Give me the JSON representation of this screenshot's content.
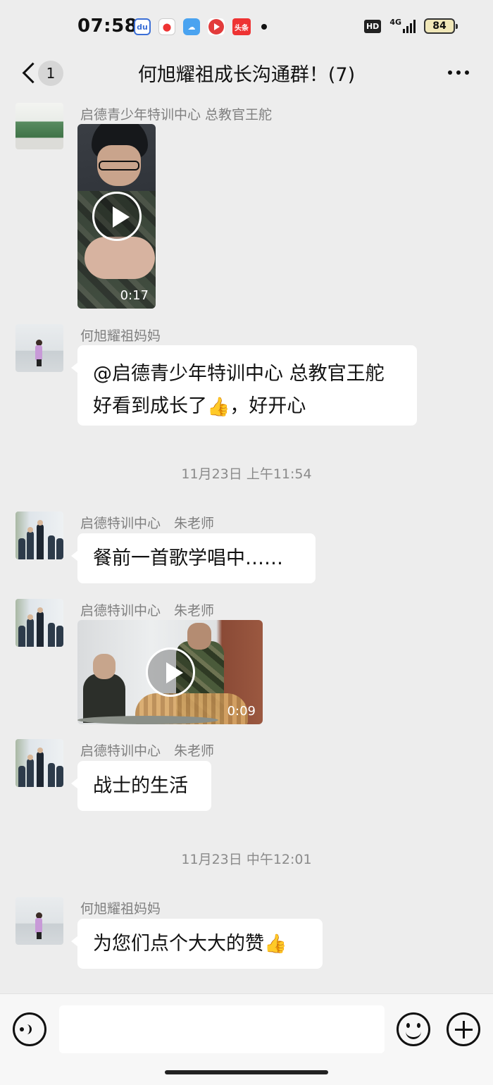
{
  "status_bar": {
    "time": "07:58",
    "app_icons": [
      "baidu-icon",
      "map-icon",
      "weather-icon",
      "video-icon",
      "toutiao-icon"
    ],
    "toutiao_label": "头条",
    "hd_label": "HD",
    "network_label": "4G",
    "battery_level": "84"
  },
  "nav": {
    "unread_count": "1",
    "title": "何旭耀祖成长沟通群！(7)"
  },
  "messages": [
    {
      "type": "video",
      "sender": "启德青少年特训中心 总教官王舵",
      "duration": "0:17"
    },
    {
      "type": "text",
      "sender": "何旭耀祖妈妈",
      "line1": "@启德青少年特训中心 总教官王舵",
      "line2_part1": " 好看到成长了",
      "line2_emoji": "👍",
      "line2_part2": "，好开心"
    },
    {
      "type": "timestamp",
      "text": "11月23日 上午11:54"
    },
    {
      "type": "text",
      "sender": "启德特训中心　朱老师",
      "text": "餐前一首歌学唱中……"
    },
    {
      "type": "video",
      "sender": "启德特训中心　朱老师",
      "duration": "0:09"
    },
    {
      "type": "text",
      "sender": "启德特训中心　朱老师",
      "text": "战士的生活"
    },
    {
      "type": "timestamp",
      "text": "11月23日 中午12:01"
    },
    {
      "type": "text",
      "sender": "何旭耀祖妈妈",
      "text": "为您们点个大大的赞",
      "emoji": "👍"
    }
  ],
  "colors": {
    "background": "#ededed",
    "bubble": "#ffffff",
    "sender_text": "#7f7f7f",
    "timestamp_text": "#8a8a8a"
  }
}
